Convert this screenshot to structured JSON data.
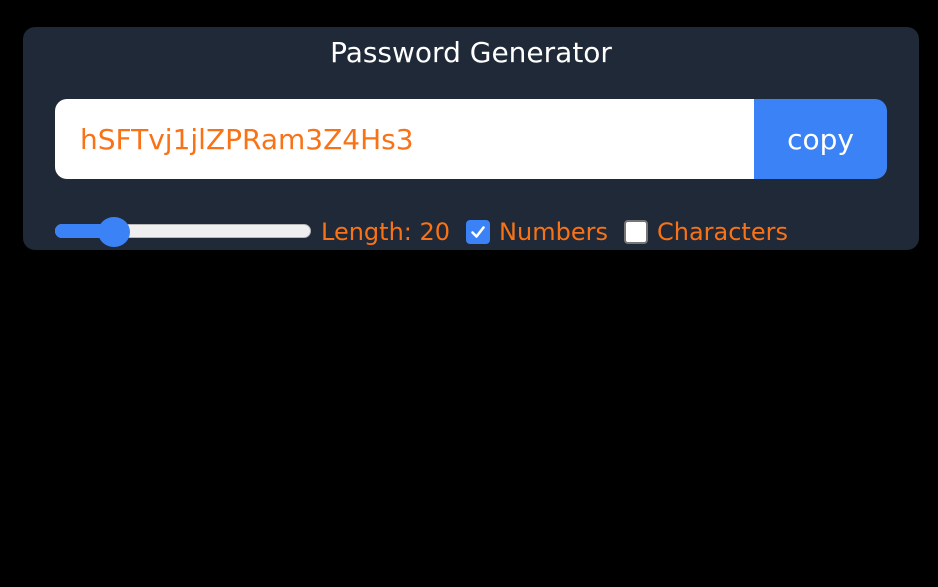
{
  "app": {
    "title": "Password Generator"
  },
  "password": {
    "value": "hSFTvj1jlZPRam3Z4Hs3"
  },
  "copy_button": {
    "label": "copy"
  },
  "length_control": {
    "label": "Length: 20",
    "value": 20,
    "fraction": 0.19
  },
  "options": {
    "numbers": {
      "label": "Numbers",
      "checked": true
    },
    "characters": {
      "label": "Characters",
      "checked": false
    }
  },
  "colors": {
    "background": "#000000",
    "card": "#1f2937",
    "accent": "#3b82f6",
    "text_accent": "#f97316",
    "title": "#ffffff"
  },
  "icons": {
    "numbers_checkbox": "checkmark-icon"
  }
}
